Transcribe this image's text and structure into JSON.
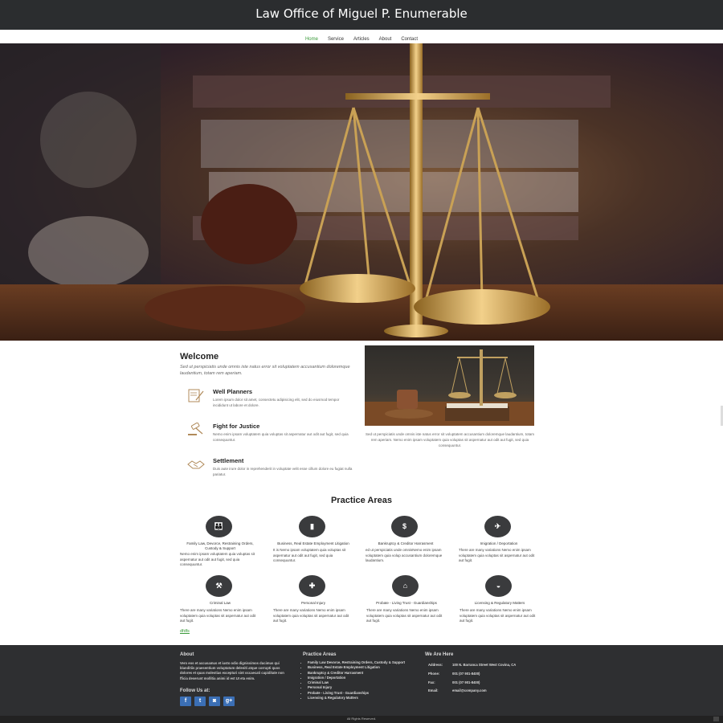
{
  "header": {
    "title": "Law Office of Miguel P. Enumerable"
  },
  "nav": {
    "items": [
      "Home",
      "Service",
      "Articles",
      "About",
      "Contact"
    ],
    "active": "Home"
  },
  "welcome": {
    "title": "Welcome",
    "lead": "Sed ut perspiciatis unde omnis iste natus error sit voluptatem accusantium doloremque laudantium, totam rem aperiam.",
    "features": [
      {
        "icon": "document-pen-icon",
        "title": "Well Planners",
        "text": "Lorem ipsum dolor sit amet, consectetu adipisicing elit, sed do eiusmod tempor incididunt ut labore et dolore."
      },
      {
        "icon": "gavel-icon",
        "title": "Fight for Justice",
        "text": "Nemo enim ipsam voluptatem quia voluptas sit aspernatur aut odit aut fugit, sed quia consequuntur."
      },
      {
        "icon": "handshake-icon",
        "title": "Settlement",
        "text": "Duis aute irure dolor in reprehenderit in voluptate velit esse cillum dolore eu fugiat nulla pariatur."
      }
    ]
  },
  "photo_text": "Sed ut perspiciatis unde omnis iste natus error sit voluptatem accusantium doloremque laudantium, totam rem aperiam. Nemo enim ipsam voluptatem quia voluptas sit aspernatur aut odit aut fugit, sed quia consequuntur.",
  "practice": {
    "title": "Practice Areas",
    "items": [
      {
        "icon": "family-icon",
        "glyph": "👪",
        "title": "Family Law, Devorce, Restraining Orders, Custody & Support",
        "desc": "Nemo enim ipsam voluptatem quia voluptas sit aspernatur aut odit aut fugit, sed quia consequuntur."
      },
      {
        "icon": "briefcase-icon",
        "glyph": "▮",
        "title": "Business, Real Estate Employment Litigation",
        "desc": "It is Nemo ipsam voluptatem quia voluptas sit aspernatur aut odit aut fugit, sed quia consequuntur."
      },
      {
        "icon": "dollar-icon",
        "glyph": "$",
        "title": "Bankruptcy & Creditor Harrasment",
        "desc": "ed ut perspiciatis unde omnisNemo enim ipsam voluptatem quia volup accusantium doloremque laudantium."
      },
      {
        "icon": "airplane-icon",
        "glyph": "✈",
        "title": "Imigration / Deportation",
        "desc": "There are many variations Nemo enim ipsam voluptatem quia voluptas sit aspernatur aut odit aut fugit."
      },
      {
        "icon": "gavel-icon",
        "glyph": "⚒",
        "title": "Criminal Law",
        "desc": "There are many variations Nemo enim ipsam voluptatem quia voluptas sit aspernatur aut odit aut fugit."
      },
      {
        "icon": "injury-icon",
        "glyph": "✚",
        "title": "Personal Injury",
        "desc": "There are many variations Nemo enim ipsam voluptatem quia voluptas sit aspernatur aut odit aut fugit."
      },
      {
        "icon": "home-icon",
        "glyph": "⌂",
        "title": "Probate - Living Trust - Guardianships",
        "desc": "There are many variations Nemo enim ipsam voluptatem quia voluptas sit aspernatur aut odit aut fugit."
      },
      {
        "icon": "car-icon",
        "glyph": "◒",
        "title": "Licensing & Regulatory Matters",
        "desc": "There are many variations Nemo enim ipsam voluptatem quia voluptas sit aspernatur aut odit aut fugit."
      }
    ],
    "link": "dfdfs"
  },
  "footer": {
    "about_title": "About",
    "about_text": "Vero eos et accusamus et iusto odio dignissimos ducimus qui blanditiis praesentium voluptatum deleniti atque corrupti quos dolores et quas molestias excepturi sint occaecati cupiditate non fficia deserunt mollitia animi id est UI eta enim.",
    "follow_title": "Follow Us at:",
    "social": [
      {
        "icon": "facebook-icon",
        "glyph": "f"
      },
      {
        "icon": "twitter-icon",
        "glyph": "t"
      },
      {
        "icon": "instagram-icon",
        "glyph": "◙"
      },
      {
        "icon": "google-plus-icon",
        "glyph": "g+"
      }
    ],
    "practice_title": "Practice Areas",
    "practice_list": [
      "Family Law Devorce, Restraining Orders, Custody & Support",
      "Business, Real Estate Employment Litigation",
      "Bankruptcy & Creditor Harrasment",
      "Imigration / Deportation",
      "Criminal Law",
      "Personal Injury",
      "Probate - Living Trust - Guardianships",
      "Licensing & Regulatory Matters"
    ],
    "contact_title": "We Are Here",
    "contact": [
      {
        "label": "Address:",
        "value": "100 N. Barranca Street West Covina, CA"
      },
      {
        "label": "Phone:",
        "value": "001 (07 901-8400)"
      },
      {
        "label": "Fax:",
        "value": "001 (07 901-8400)"
      },
      {
        "label": "Email:",
        "value": "email@company.com"
      }
    ]
  },
  "copyright": "All Rights Reserved."
}
